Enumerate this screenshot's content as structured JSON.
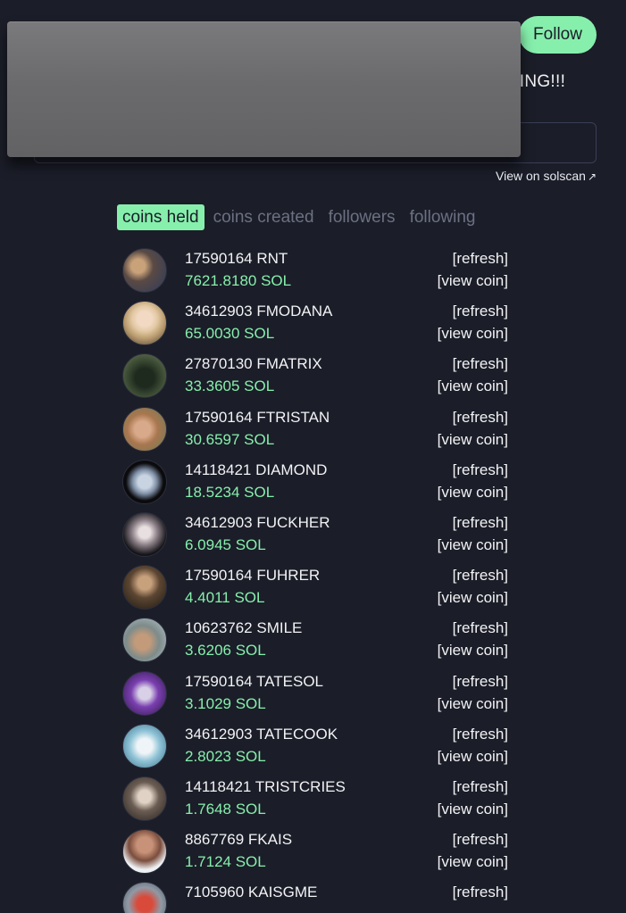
{
  "header": {
    "follow_label": "Follow",
    "bio_visible": "LLING!!!",
    "solscan_label": "View on solscan",
    "solscan_icon": "external-arrow-icon"
  },
  "tabs": [
    {
      "label": "coins held",
      "active": true
    },
    {
      "label": "coins created",
      "active": false
    },
    {
      "label": "followers",
      "active": false
    },
    {
      "label": "following",
      "active": false
    }
  ],
  "colors": {
    "accent": "#86efac",
    "background": "#1b1d28",
    "tab_inactive": "#6b7083"
  },
  "coins": [
    {
      "name": "17590164 RNT",
      "value": "7621.8180 SOL",
      "refresh": "[refresh]",
      "view": "[view coin]",
      "avatar": "avatar-1"
    },
    {
      "name": "34612903 FMODANA",
      "value": "65.0030 SOL",
      "refresh": "[refresh]",
      "view": "[view coin]",
      "avatar": "avatar-2"
    },
    {
      "name": "27870130 FMATRIX",
      "value": "33.3605 SOL",
      "refresh": "[refresh]",
      "view": "[view coin]",
      "avatar": "avatar-3"
    },
    {
      "name": "17590164 FTRISTAN",
      "value": "30.6597 SOL",
      "refresh": "[refresh]",
      "view": "[view coin]",
      "avatar": "avatar-4"
    },
    {
      "name": "14118421 DIAMOND",
      "value": "18.5234 SOL",
      "refresh": "[refresh]",
      "view": "[view coin]",
      "avatar": "avatar-5"
    },
    {
      "name": "34612903 FUCKHER",
      "value": "6.0945 SOL",
      "refresh": "[refresh]",
      "view": "[view coin]",
      "avatar": "avatar-6"
    },
    {
      "name": "17590164 FUHRER",
      "value": "4.4011 SOL",
      "refresh": "[refresh]",
      "view": "[view coin]",
      "avatar": "avatar-7"
    },
    {
      "name": "10623762 SMILE",
      "value": "3.6206 SOL",
      "refresh": "[refresh]",
      "view": "[view coin]",
      "avatar": "avatar-8"
    },
    {
      "name": "17590164 TATESOL",
      "value": "3.1029 SOL",
      "refresh": "[refresh]",
      "view": "[view coin]",
      "avatar": "avatar-9"
    },
    {
      "name": "34612903 TATECOOK",
      "value": "2.8023 SOL",
      "refresh": "[refresh]",
      "view": "[view coin]",
      "avatar": "avatar-10"
    },
    {
      "name": "14118421 TRISTCRIES",
      "value": "1.7648 SOL",
      "refresh": "[refresh]",
      "view": "[view coin]",
      "avatar": "avatar-11"
    },
    {
      "name": "8867769 FKAIS",
      "value": "1.7124 SOL",
      "refresh": "[refresh]",
      "view": "[view coin]",
      "avatar": "avatar-12"
    },
    {
      "name": "7105960 KAISGME",
      "value": "",
      "refresh": "[refresh]",
      "view": "",
      "avatar": "avatar-13"
    }
  ]
}
